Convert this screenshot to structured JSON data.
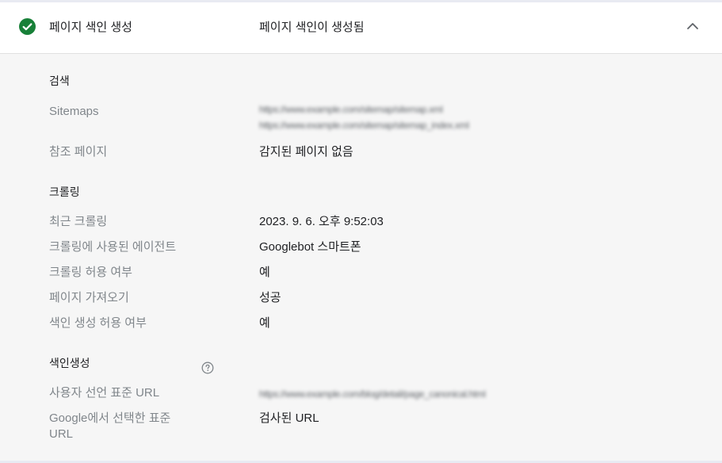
{
  "header": {
    "title": "페이지 색인 생성",
    "status": "페이지 색인이 생성됨",
    "status_icon": "check-circle-icon",
    "collapse_icon": "chevron-up-icon"
  },
  "sections": {
    "discovery": {
      "title": "검색",
      "sitemaps_label": "Sitemaps",
      "sitemap_1": "https://www.example.com/sitemap/sitemap.xml",
      "sitemap_2": "https://www.example.com/sitemap/sitemap_index.xml",
      "referring_label": "참조 페이지",
      "referring_value": "감지된 페이지 없음"
    },
    "crawl": {
      "title": "크롤링",
      "last_crawl_label": "최근 크롤링",
      "last_crawl_value": "2023. 9. 6. 오후 9:52:03",
      "agent_label": "크롤링에 사용된 에이전트",
      "agent_value": "Googlebot 스마트폰",
      "allowed_label": "크롤링 허용 여부",
      "allowed_value": "예",
      "fetch_label": "페이지 가져오기",
      "fetch_value": "성공",
      "indexing_allowed_label": "색인 생성 허용 여부",
      "indexing_allowed_value": "예"
    },
    "indexing": {
      "title": "색인생성",
      "user_canonical_label": "사용자 선언 표준 URL",
      "user_canonical_value": "https://www.example.com/blog/detail/page_canonical.html",
      "google_canonical_label": "Google에서 선택한 표준 URL",
      "google_canonical_value": "검사된 URL",
      "help_icon": "help-circle-icon"
    }
  },
  "colors": {
    "success": "#188038",
    "label": "#80868b",
    "text": "#202124",
    "panel_bg": "#f6f6f6"
  }
}
